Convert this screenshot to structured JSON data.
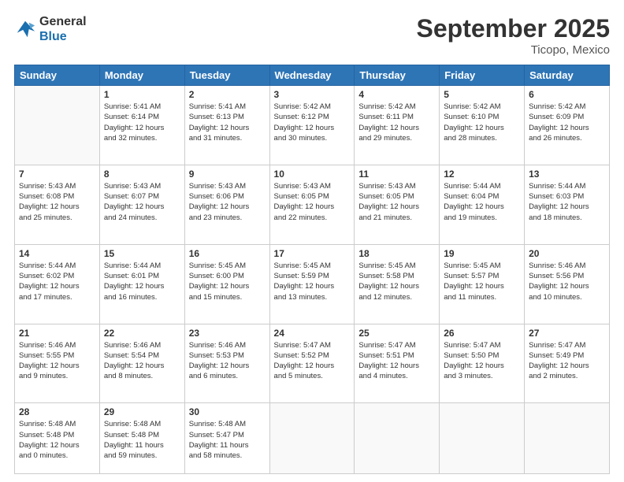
{
  "header": {
    "logo_line1": "General",
    "logo_line2": "Blue",
    "month": "September 2025",
    "location": "Ticopo, Mexico"
  },
  "weekdays": [
    "Sunday",
    "Monday",
    "Tuesday",
    "Wednesday",
    "Thursday",
    "Friday",
    "Saturday"
  ],
  "weeks": [
    [
      {
        "day": "",
        "info": ""
      },
      {
        "day": "1",
        "info": "Sunrise: 5:41 AM\nSunset: 6:14 PM\nDaylight: 12 hours\nand 32 minutes."
      },
      {
        "day": "2",
        "info": "Sunrise: 5:41 AM\nSunset: 6:13 PM\nDaylight: 12 hours\nand 31 minutes."
      },
      {
        "day": "3",
        "info": "Sunrise: 5:42 AM\nSunset: 6:12 PM\nDaylight: 12 hours\nand 30 minutes."
      },
      {
        "day": "4",
        "info": "Sunrise: 5:42 AM\nSunset: 6:11 PM\nDaylight: 12 hours\nand 29 minutes."
      },
      {
        "day": "5",
        "info": "Sunrise: 5:42 AM\nSunset: 6:10 PM\nDaylight: 12 hours\nand 28 minutes."
      },
      {
        "day": "6",
        "info": "Sunrise: 5:42 AM\nSunset: 6:09 PM\nDaylight: 12 hours\nand 26 minutes."
      }
    ],
    [
      {
        "day": "7",
        "info": "Sunrise: 5:43 AM\nSunset: 6:08 PM\nDaylight: 12 hours\nand 25 minutes."
      },
      {
        "day": "8",
        "info": "Sunrise: 5:43 AM\nSunset: 6:07 PM\nDaylight: 12 hours\nand 24 minutes."
      },
      {
        "day": "9",
        "info": "Sunrise: 5:43 AM\nSunset: 6:06 PM\nDaylight: 12 hours\nand 23 minutes."
      },
      {
        "day": "10",
        "info": "Sunrise: 5:43 AM\nSunset: 6:05 PM\nDaylight: 12 hours\nand 22 minutes."
      },
      {
        "day": "11",
        "info": "Sunrise: 5:43 AM\nSunset: 6:05 PM\nDaylight: 12 hours\nand 21 minutes."
      },
      {
        "day": "12",
        "info": "Sunrise: 5:44 AM\nSunset: 6:04 PM\nDaylight: 12 hours\nand 19 minutes."
      },
      {
        "day": "13",
        "info": "Sunrise: 5:44 AM\nSunset: 6:03 PM\nDaylight: 12 hours\nand 18 minutes."
      }
    ],
    [
      {
        "day": "14",
        "info": "Sunrise: 5:44 AM\nSunset: 6:02 PM\nDaylight: 12 hours\nand 17 minutes."
      },
      {
        "day": "15",
        "info": "Sunrise: 5:44 AM\nSunset: 6:01 PM\nDaylight: 12 hours\nand 16 minutes."
      },
      {
        "day": "16",
        "info": "Sunrise: 5:45 AM\nSunset: 6:00 PM\nDaylight: 12 hours\nand 15 minutes."
      },
      {
        "day": "17",
        "info": "Sunrise: 5:45 AM\nSunset: 5:59 PM\nDaylight: 12 hours\nand 13 minutes."
      },
      {
        "day": "18",
        "info": "Sunrise: 5:45 AM\nSunset: 5:58 PM\nDaylight: 12 hours\nand 12 minutes."
      },
      {
        "day": "19",
        "info": "Sunrise: 5:45 AM\nSunset: 5:57 PM\nDaylight: 12 hours\nand 11 minutes."
      },
      {
        "day": "20",
        "info": "Sunrise: 5:46 AM\nSunset: 5:56 PM\nDaylight: 12 hours\nand 10 minutes."
      }
    ],
    [
      {
        "day": "21",
        "info": "Sunrise: 5:46 AM\nSunset: 5:55 PM\nDaylight: 12 hours\nand 9 minutes."
      },
      {
        "day": "22",
        "info": "Sunrise: 5:46 AM\nSunset: 5:54 PM\nDaylight: 12 hours\nand 8 minutes."
      },
      {
        "day": "23",
        "info": "Sunrise: 5:46 AM\nSunset: 5:53 PM\nDaylight: 12 hours\nand 6 minutes."
      },
      {
        "day": "24",
        "info": "Sunrise: 5:47 AM\nSunset: 5:52 PM\nDaylight: 12 hours\nand 5 minutes."
      },
      {
        "day": "25",
        "info": "Sunrise: 5:47 AM\nSunset: 5:51 PM\nDaylight: 12 hours\nand 4 minutes."
      },
      {
        "day": "26",
        "info": "Sunrise: 5:47 AM\nSunset: 5:50 PM\nDaylight: 12 hours\nand 3 minutes."
      },
      {
        "day": "27",
        "info": "Sunrise: 5:47 AM\nSunset: 5:49 PM\nDaylight: 12 hours\nand 2 minutes."
      }
    ],
    [
      {
        "day": "28",
        "info": "Sunrise: 5:48 AM\nSunset: 5:48 PM\nDaylight: 12 hours\nand 0 minutes."
      },
      {
        "day": "29",
        "info": "Sunrise: 5:48 AM\nSunset: 5:48 PM\nDaylight: 11 hours\nand 59 minutes."
      },
      {
        "day": "30",
        "info": "Sunrise: 5:48 AM\nSunset: 5:47 PM\nDaylight: 11 hours\nand 58 minutes."
      },
      {
        "day": "",
        "info": ""
      },
      {
        "day": "",
        "info": ""
      },
      {
        "day": "",
        "info": ""
      },
      {
        "day": "",
        "info": ""
      }
    ]
  ]
}
